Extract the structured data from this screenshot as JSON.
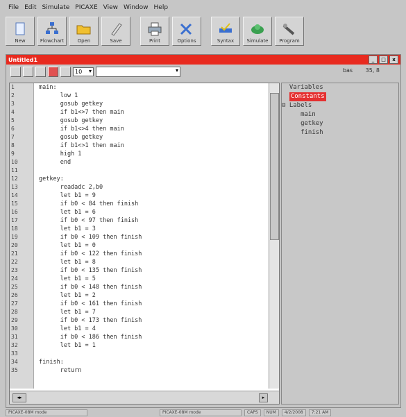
{
  "menu": [
    "File",
    "Edit",
    "Simulate",
    "PICAXE",
    "View",
    "Window",
    "Help"
  ],
  "toolbar": [
    {
      "label": "New",
      "icon": "new-file-icon"
    },
    {
      "label": "Flowchart",
      "icon": "flowchart-icon"
    },
    {
      "label": "Open",
      "icon": "open-folder-icon"
    },
    {
      "label": "Save",
      "icon": "save-icon"
    },
    {
      "label": "Print",
      "icon": "print-icon"
    },
    {
      "label": "Options",
      "icon": "options-icon"
    },
    {
      "label": "Syntax",
      "icon": "syntax-icon"
    },
    {
      "label": "Simulate",
      "icon": "simulate-icon"
    },
    {
      "label": "Program",
      "icon": "program-icon"
    }
  ],
  "window": {
    "title": "Untitled1",
    "controls": [
      "_",
      "□",
      "x"
    ],
    "font_size": "10",
    "status_left": "bas",
    "status_right": "35, 8"
  },
  "editor": {
    "line_numbers": [
      "1",
      "2",
      "3",
      "4",
      "5",
      "6",
      "7",
      "8",
      "9",
      "10",
      "11",
      "12",
      "13",
      "14",
      "15",
      "16",
      "17",
      "18",
      "19",
      "20",
      "21",
      "22",
      "23",
      "24",
      "25",
      "26",
      "27",
      "28",
      "29",
      "30",
      "31",
      "32",
      "33",
      "34",
      "35"
    ],
    "lines": [
      "main:",
      "      low 1",
      "      gosub getkey",
      "      if b1<>7 then main",
      "      gosub getkey",
      "      if b1<>4 then main",
      "      gosub getkey",
      "      if b1<>1 then main",
      "      high 1",
      "      end",
      "",
      "getkey:",
      "      readadc 2,b0",
      "      let b1 = 9",
      "      if b0 < 84 then finish",
      "      let b1 = 6",
      "      if b0 < 97 then finish",
      "      let b1 = 3",
      "      if b0 < 109 then finish",
      "      let b1 = 0",
      "      if b0 < 122 then finish",
      "      let b1 = 8",
      "      if b0 < 135 then finish",
      "      let b1 = 5",
      "      if b0 < 148 then finish",
      "      let b1 = 2",
      "      if b0 < 161 then finish",
      "      let b1 = 7",
      "      if b0 < 173 then finish",
      "      let b1 = 4",
      "      if b0 < 186 then finish",
      "      let b1 = 1",
      "",
      "finish:",
      "      return"
    ]
  },
  "tree": {
    "items": [
      "Variables",
      "Constants",
      "Labels"
    ],
    "labels": [
      "main",
      "getkey",
      "finish"
    ],
    "selected": "Constants"
  },
  "statusbar": [
    "PICAXE-08M mode",
    "PICAXE-08M mode",
    "CAPS",
    "NUM",
    "4/2/2008",
    "7:21 AM"
  ],
  "colors": {
    "titlebar": "#e82a1f",
    "keyword": "#3a32b4",
    "number": "#b03070"
  }
}
